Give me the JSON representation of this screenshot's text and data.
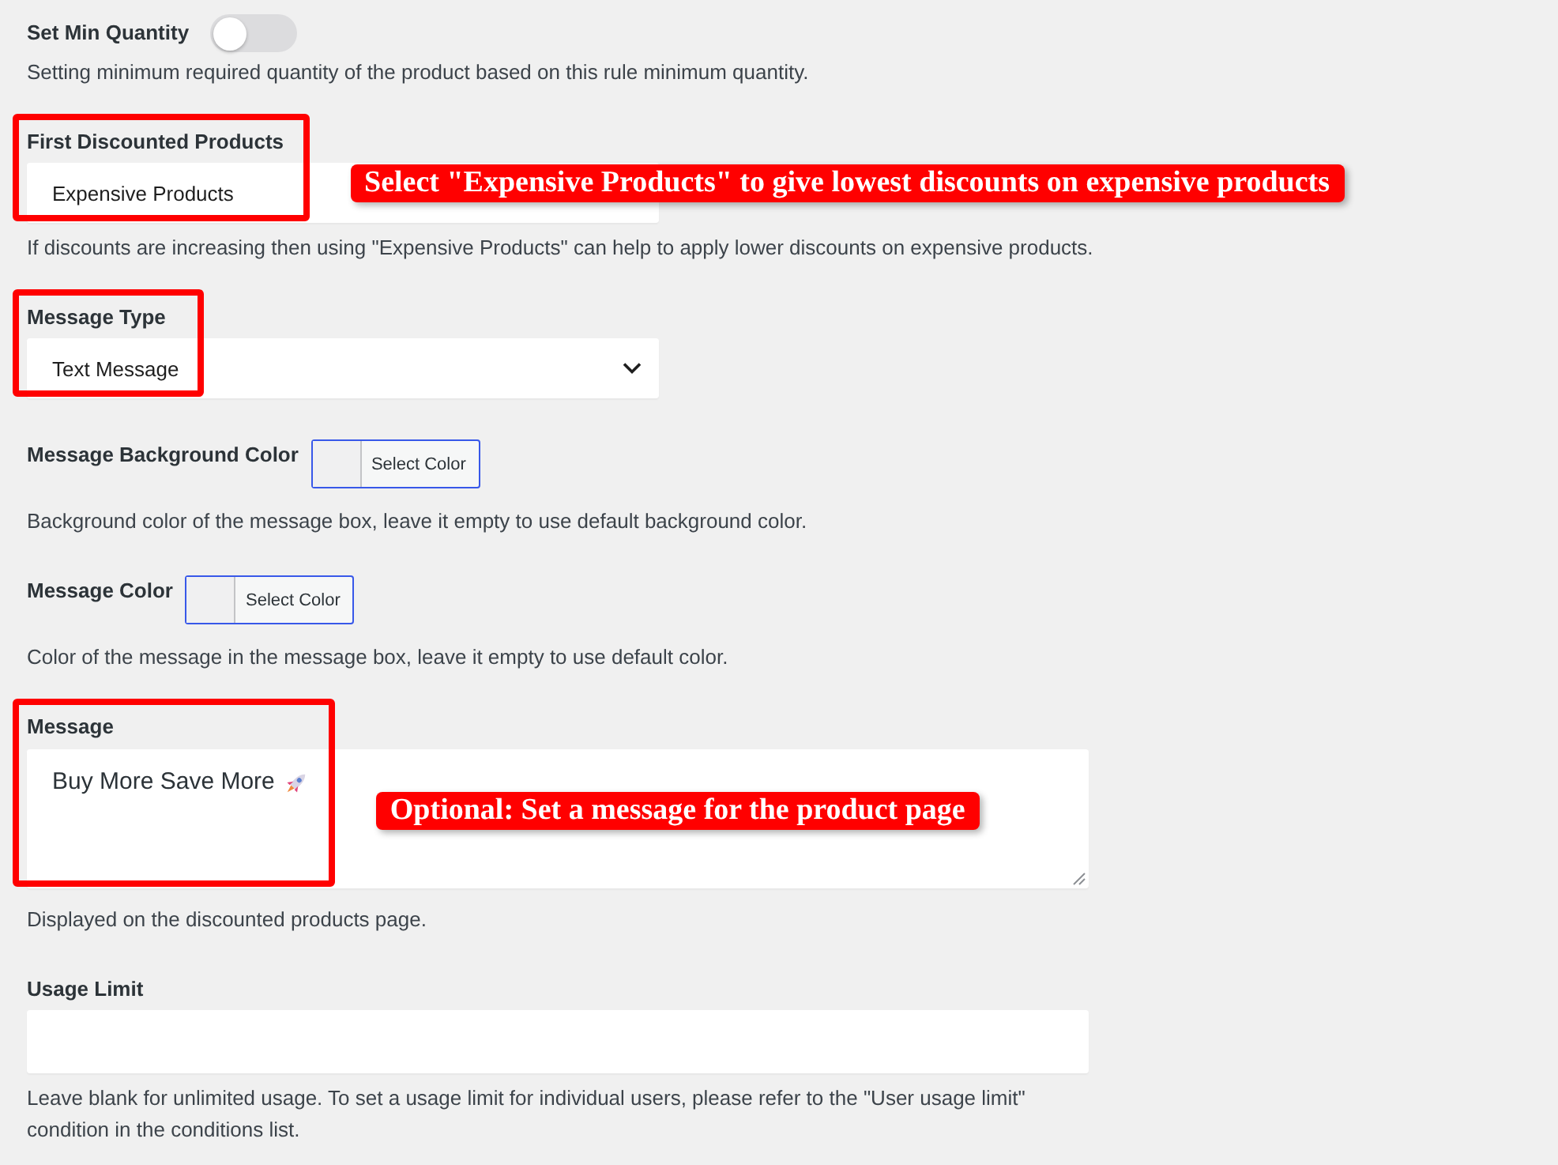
{
  "fields": [
    {
      "kind": "toggle",
      "label": "Set Min Quantity",
      "on": false,
      "description": "Setting minimum required quantity of the product based on this rule minimum quantity."
    },
    {
      "kind": "select",
      "label": "First Discounted Products",
      "value": "Expensive Products",
      "highlighted": true,
      "callout": "Select \"Expensive Products\" to give lowest discounts on expensive products",
      "description": "If discounts are increasing then using \"Expensive Products\" can help to apply lower discounts on expensive products."
    },
    {
      "kind": "select",
      "label": "Message Type",
      "value": "Text Message",
      "highlighted": true
    },
    {
      "kind": "color",
      "label": "Message Background Color",
      "button": "Select Color",
      "description": "Background color of the message box, leave it empty to use default background color."
    },
    {
      "kind": "color",
      "label": "Message Color",
      "button": "Select Color",
      "description": "Color of the message in the message box, leave it empty to use default color."
    },
    {
      "kind": "textarea",
      "label": "Message",
      "value": "Buy More Save More",
      "has_emoji": true,
      "highlighted": true,
      "callout": "Optional: Set a message for the product page",
      "description": "Displayed on the discounted products page."
    },
    {
      "kind": "input",
      "label": "Usage Limit",
      "highlighted": false,
      "description": "Leave blank for unlimited usage. To set a usage limit for individual users, please refer to the \"User usage limit\" condition in the conditions list."
    }
  ]
}
